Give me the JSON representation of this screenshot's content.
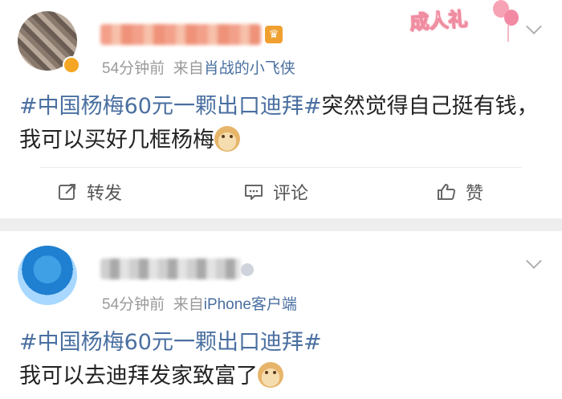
{
  "posts": [
    {
      "time": "54分钟前",
      "from_prefix": "来自",
      "source": "肖战的小飞侠",
      "hashtag": "#中国杨梅60元一颗出口迪拜#",
      "body": "突然觉得自己挺有钱，我可以买好几框杨梅",
      "badge": "成人礼",
      "actions": {
        "repost": "转发",
        "comment": "评论",
        "like": "赞"
      }
    },
    {
      "time": "54分钟前",
      "from_prefix": "来自",
      "source": "iPhone客户端",
      "hashtag": "#中国杨梅60元一颗出口迪拜#",
      "body": "我可以去迪拜发家致富了"
    }
  ],
  "icons": {
    "repost": "share-edit-icon",
    "comment": "comment-icon",
    "like": "thumbs-up-icon",
    "more": "chevron-down-icon",
    "emoji": "doge-emoji-icon",
    "member": "crown-icon"
  },
  "colors": {
    "link": "#4a6fa0",
    "meta": "#9a9a9a",
    "text": "#222222",
    "separator": "#eeeeee"
  }
}
